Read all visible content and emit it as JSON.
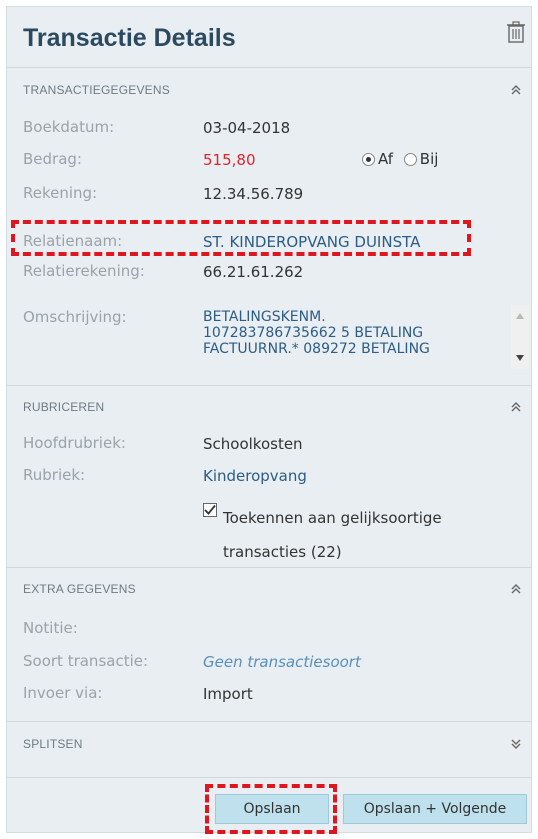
{
  "header": {
    "title": "Transactie Details"
  },
  "sections": {
    "transactiegegevens": {
      "title": "TRANSACTIEGEGEVENS",
      "boekdatum_label": "Boekdatum:",
      "boekdatum": "03-04-2018",
      "bedrag_label": "Bedrag:",
      "bedrag": "515,80",
      "af_label": "Af",
      "bij_label": "Bij",
      "selected": "Af",
      "rekening_label": "Rekening:",
      "rekening": "12.34.56.789",
      "relatienaam_label": "Relatienaam:",
      "relatienaam": "ST. KINDEROPVANG DUINSTA",
      "relatierekening_label": "Relatierekening:",
      "relatierekening": "66.21.61.262",
      "omschrijving_label": "Omschrijving:",
      "omschrijving_lines": [
        "BETALINGSKENM.",
        "107283786735662 5 BETALING",
        "FACTUURNR.* 089272 BETALING"
      ]
    },
    "rubriceren": {
      "title": "RUBRICEREN",
      "hoofdrubriek_label": "Hoofdrubriek:",
      "hoofdrubriek": "Schoolkosten",
      "rubriek_label": "Rubriek:",
      "rubriek": "Kinderopvang",
      "toekennen_label": "Toekennen aan gelijksoortige transacties (22)",
      "toekennen_checked": true
    },
    "extra": {
      "title": "EXTRA GEGEVENS",
      "notitie_label": "Notitie:",
      "soort_label": "Soort transactie:",
      "soort": "Geen transactiesoort",
      "invoer_label": "Invoer via:",
      "invoer": "Import"
    },
    "splitsen": {
      "title": "SPLITSEN"
    }
  },
  "buttons": {
    "save": "Opslaan",
    "save_next": "Opslaan + Volgende"
  },
  "colors": {
    "accent": "#2b4a60",
    "amount": "#e0242b",
    "highlight": "#e0161e",
    "button": "#bfe1ee"
  }
}
